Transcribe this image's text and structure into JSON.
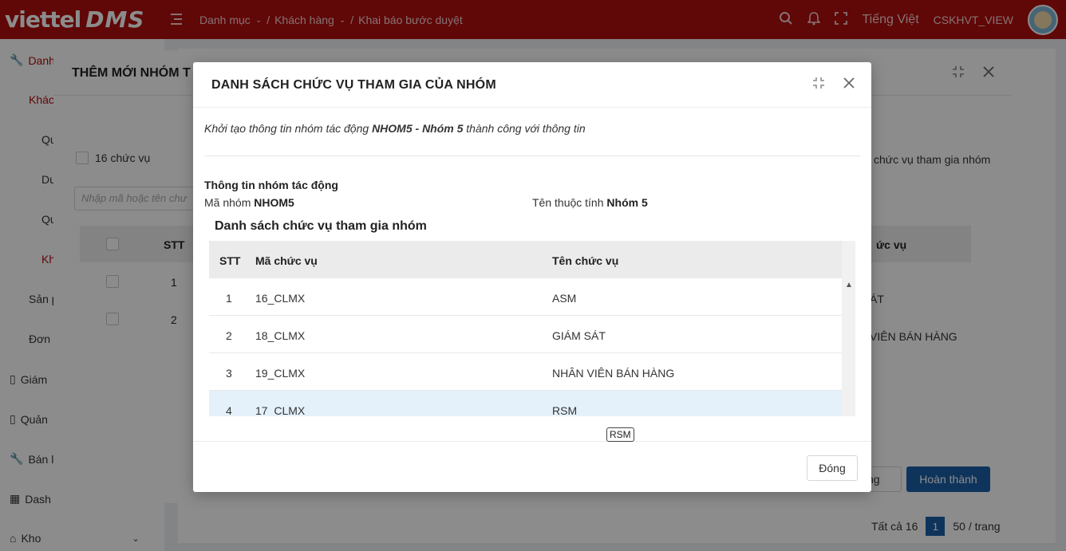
{
  "header": {
    "logo_left": "viettel",
    "logo_right": "DMS",
    "breadcrumbs": [
      "Danh mục",
      "Khách hàng",
      "Khai báo bước duyệt"
    ],
    "language": "Tiếng Việt",
    "username": "CSKHVT_VIEW"
  },
  "sidebar": {
    "items": [
      {
        "label": "Danh",
        "icon": "wrench-icon"
      },
      {
        "label": "Khác"
      },
      {
        "label": "Qu"
      },
      {
        "label": "Du"
      },
      {
        "label": "Qu"
      },
      {
        "label": "Kh"
      },
      {
        "label": "Sản p"
      },
      {
        "label": "Đơn"
      },
      {
        "label": "Giám",
        "icon": "map-icon"
      },
      {
        "label": "Quản",
        "icon": "map-icon"
      },
      {
        "label": "Bán l",
        "icon": "wrench-icon"
      },
      {
        "label": "Dash",
        "icon": "grid-icon"
      },
      {
        "label": "Kho",
        "icon": "home-icon"
      }
    ]
  },
  "background_modal": {
    "title": "THÊM MỚI NHÓM T",
    "left_checkbox_label": "16 chức vụ",
    "search_placeholder": "Nhập mã hoặc tên chư",
    "table_header_stt": "STT",
    "rows_stt": [
      "1",
      "2"
    ],
    "right_label": "chức vụ tham gia nhóm",
    "right_header": "ức vụ",
    "right_rows": [
      "ÁT",
      "VIÊN BÁN HÀNG"
    ],
    "cancel_label": "ng",
    "finish_label": "Hoàn thành"
  },
  "bg_pagination": {
    "total": "Tất cả 16",
    "page": "1",
    "page_size": "50 / trang"
  },
  "modal": {
    "title": "DANH SÁCH CHỨC VỤ THAM GIA CỦA NHÓM",
    "message_prefix": "Khởi tạo thông tin nhóm tác động",
    "message_group": "NHOM5 - Nhóm 5",
    "message_suffix": "thành công với thông tin",
    "section_title": "Thông tin nhóm tác động",
    "group_code_label": "Mã nhóm",
    "group_code": "NHOM5",
    "group_name_label": "Tên thuộc tính",
    "group_name": "Nhóm 5",
    "list_title": "Danh sách chức vụ tham gia nhóm",
    "columns": {
      "stt": "STT",
      "code": "Mã chức vụ",
      "name": "Tên chức vụ"
    },
    "rows": [
      {
        "stt": "1",
        "code": "16_CLMX",
        "name": "ASM"
      },
      {
        "stt": "2",
        "code": "18_CLMX",
        "name": "GIÁM SÁT"
      },
      {
        "stt": "3",
        "code": "19_CLMX",
        "name": "NHÂN VIÊN BÁN HÀNG"
      },
      {
        "stt": "4",
        "code": "17_CLMX",
        "name": "RSM"
      }
    ],
    "tooltip": "RSM",
    "close_label": "Đóng"
  }
}
